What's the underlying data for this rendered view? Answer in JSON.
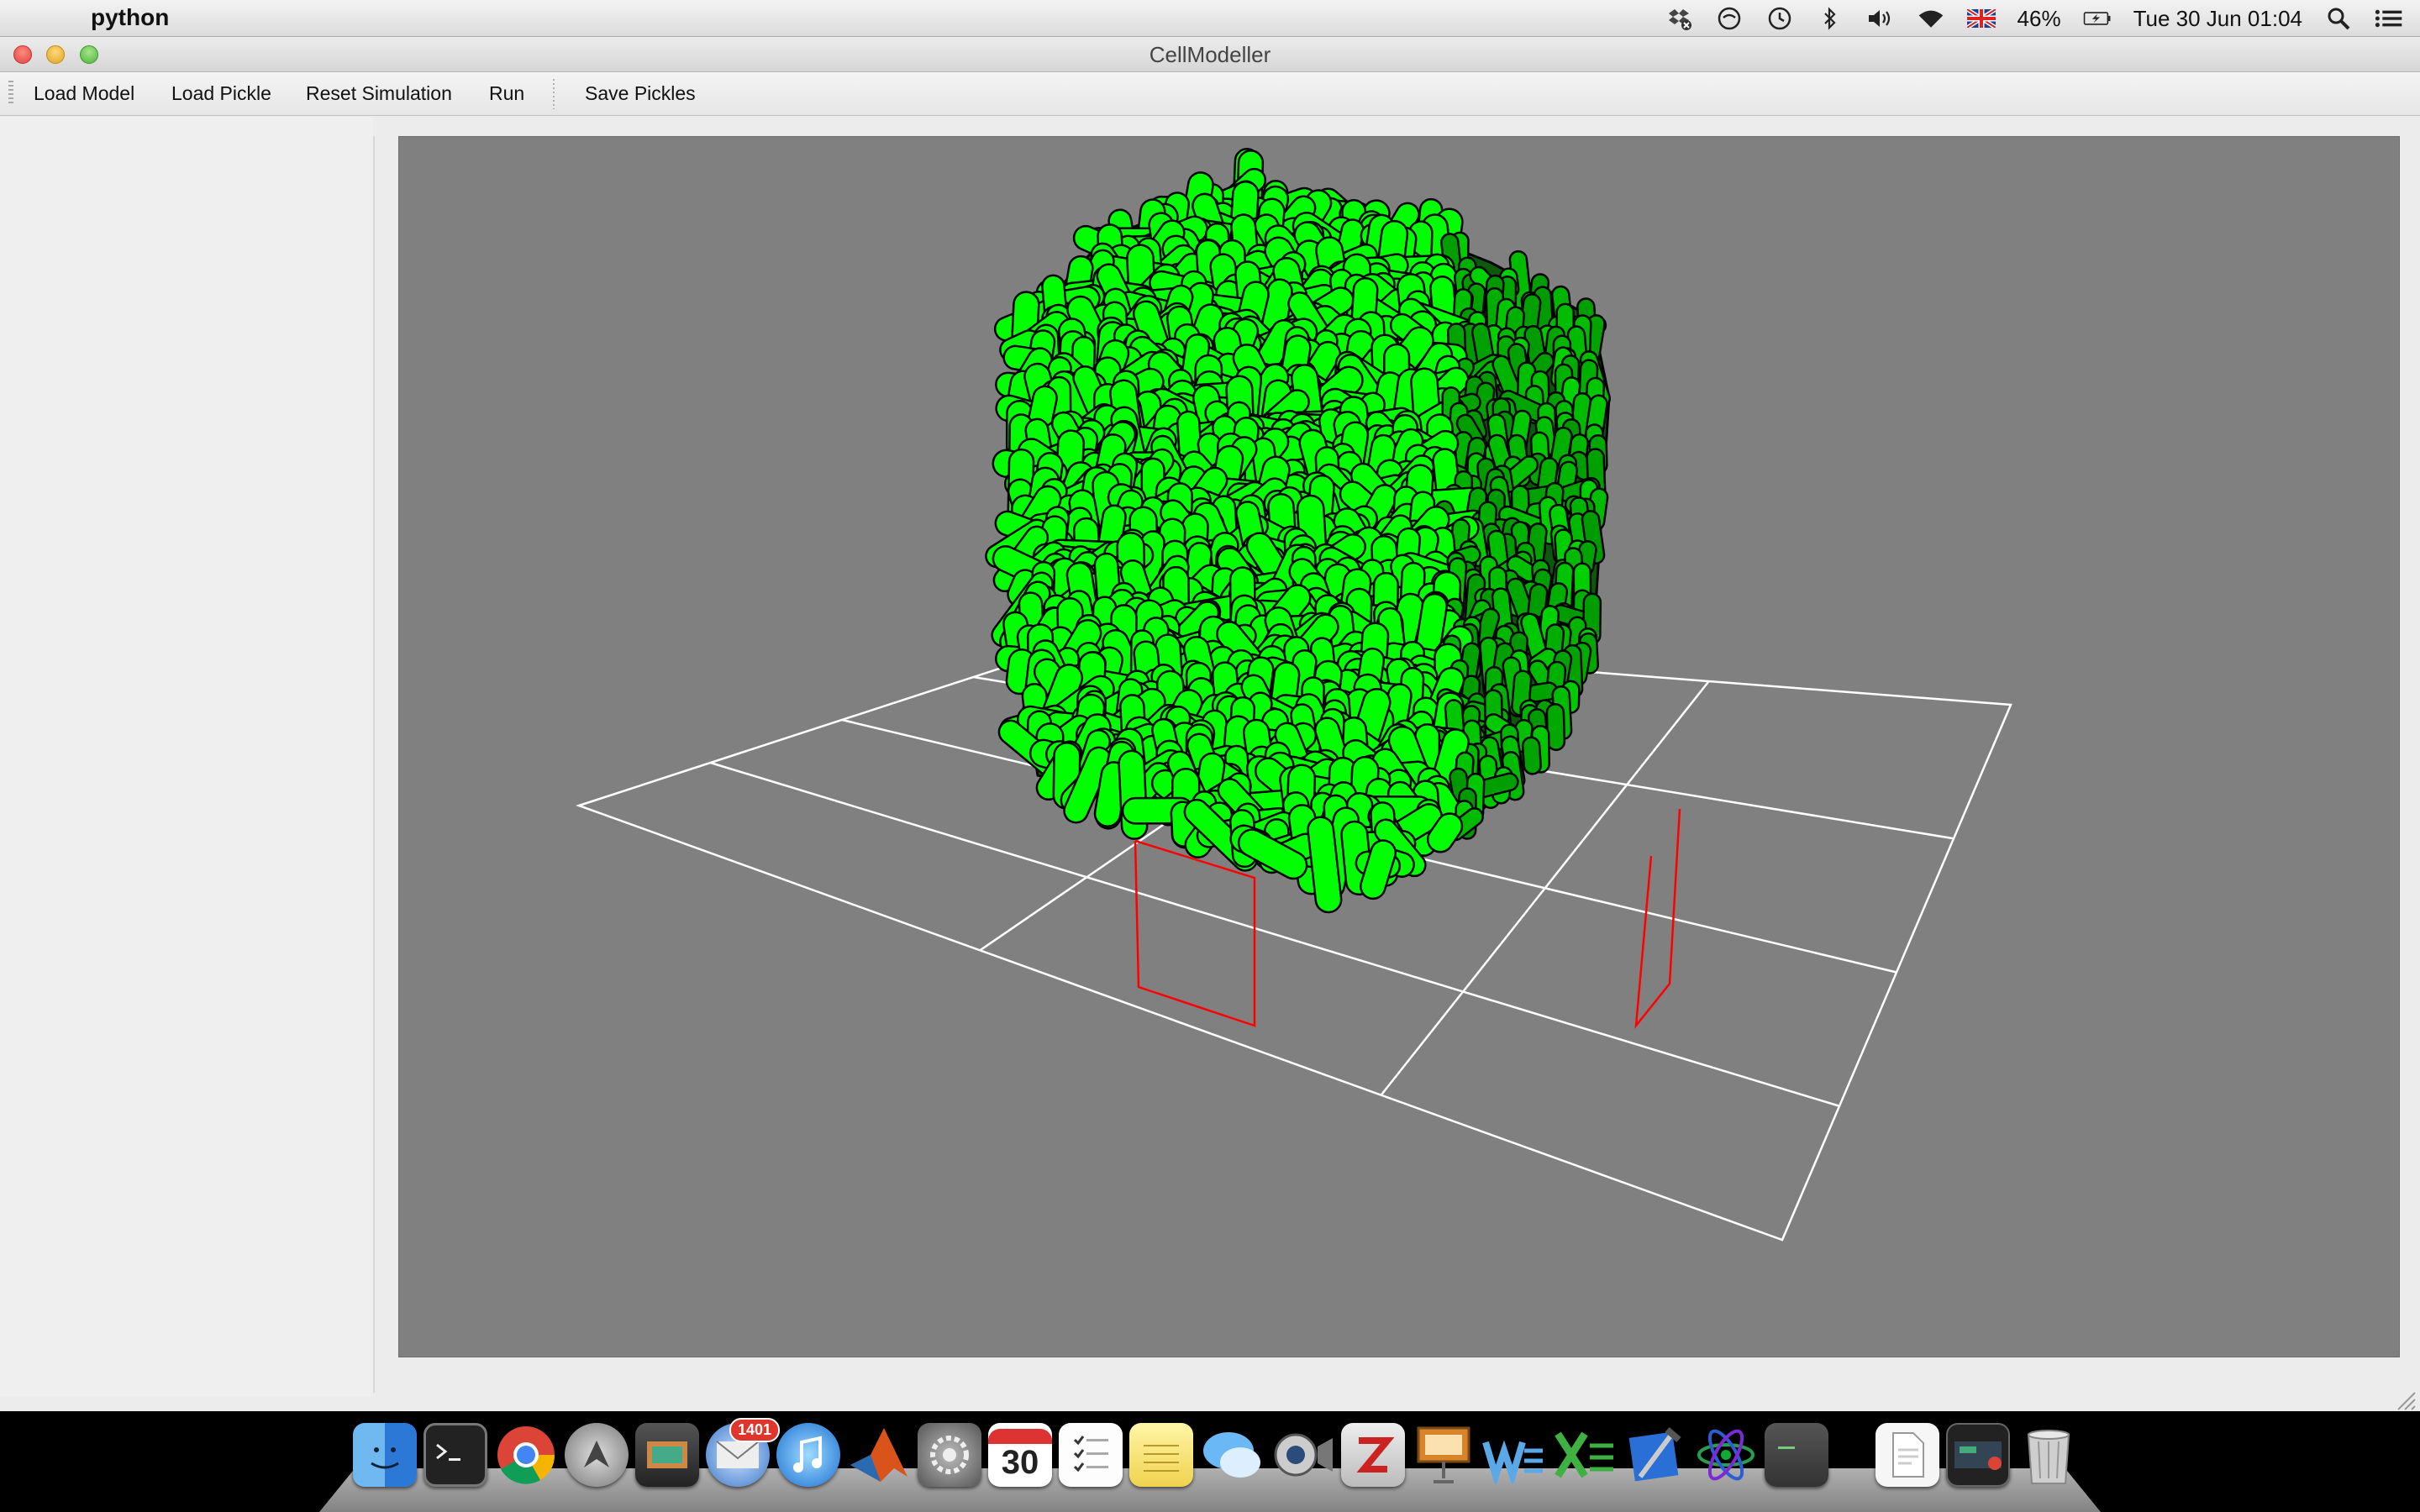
{
  "menubar": {
    "apple_glyph": "",
    "app_name": "python",
    "battery": "46%",
    "datetime": "Tue 30 Jun  01:04"
  },
  "window": {
    "title": "CellModeller"
  },
  "toolbar": {
    "load_model": "Load Model",
    "load_pickle": "Load Pickle",
    "reset_simulation": "Reset Simulation",
    "run": "Run",
    "save_pickles": "Save Pickles"
  },
  "viewport": {
    "background": "#808080",
    "cell_color": "#00ff00",
    "grid_color": "#ffffff",
    "marker_color": "#ff0000"
  },
  "dock": {
    "mail_badge": "1401",
    "calendar_day": "30",
    "items": [
      "finder",
      "terminal",
      "chrome",
      "launchpad",
      "image-capture",
      "mail",
      "itunes",
      "matlab",
      "system-preferences",
      "calendar",
      "reminders",
      "notes",
      "messages",
      "facetime",
      "zotero",
      "keynote",
      "word",
      "excel",
      "xcode",
      "molecule-viewer",
      "console",
      "pdf-document",
      "screenshot",
      "trash"
    ]
  }
}
